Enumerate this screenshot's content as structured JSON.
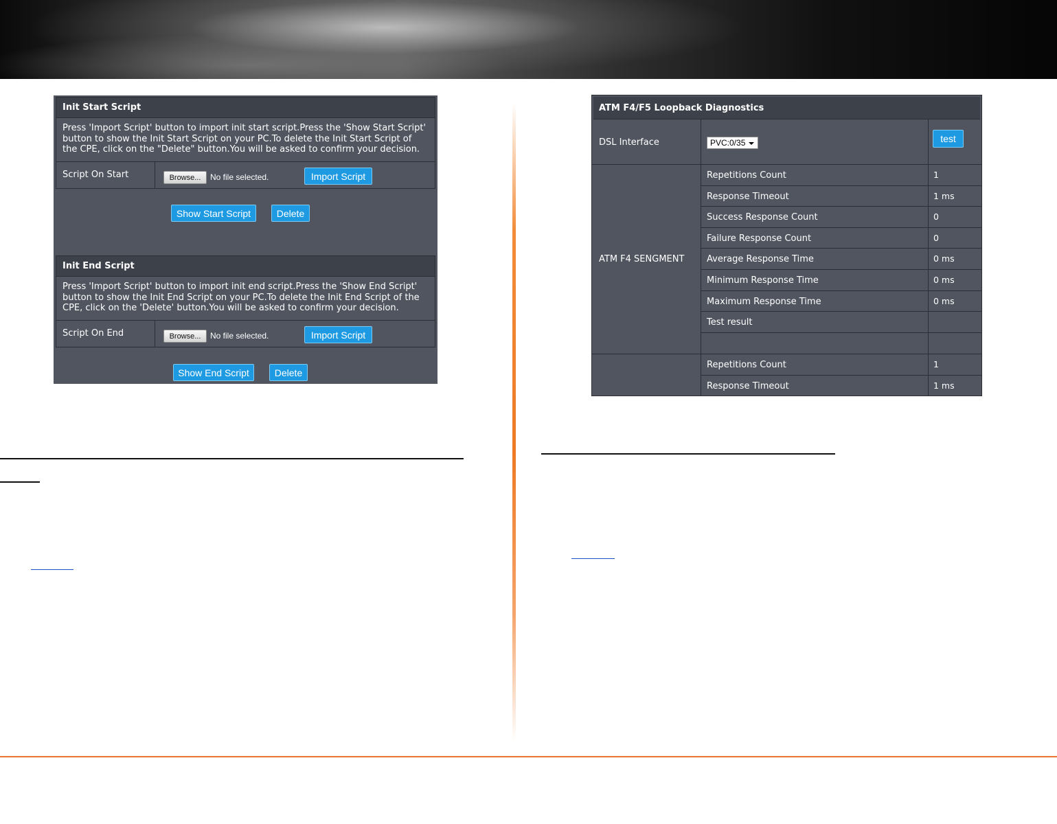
{
  "init_start": {
    "title": "Init Start Script",
    "description": "Press 'Import Script' button to import init start script.Press the 'Show Start Script' button to show the Init Start Script on your PC.To delete the Init Start Script of the CPE, click on the \"Delete\" button.You will be asked to confirm your decision.",
    "field_label": "Script On Start",
    "browse_label": "Browse...",
    "file_status": "No file selected.",
    "import_label": "Import Script",
    "show_label": "Show Start Script",
    "delete_label": "Delete"
  },
  "init_end": {
    "title": "Init End Script",
    "description": "Press 'Import Script' button to import init end script.Press the 'Show End Script' button to show the Init End Script on your PC.To delete the Init End Script of the CPE, click on the 'Delete' button.You will be asked to confirm your decision.",
    "field_label": "Script On End",
    "browse_label": "Browse...",
    "file_status": "No file selected.",
    "import_label": "Import Script",
    "show_label": "Show End Script",
    "delete_label": "Delete"
  },
  "atm": {
    "title": "ATM F4/F5 Loopback Diagnostics",
    "dsl_label": "DSL Interface",
    "dsl_value": "PVC:0/35",
    "test_label": "test",
    "segment_label": "ATM F4 SENGMENT",
    "rows": [
      {
        "label": "Repetitions Count",
        "value": "1"
      },
      {
        "label": "Response Timeout",
        "value": "1 ms"
      },
      {
        "label": "Success Response Count",
        "value": "0"
      },
      {
        "label": "Failure Response Count",
        "value": "0"
      },
      {
        "label": "Average Response Time",
        "value": "0 ms"
      },
      {
        "label": "Minimum Response Time",
        "value": "0 ms"
      },
      {
        "label": "Maximum Response Time",
        "value": "0 ms"
      },
      {
        "label": "Test result",
        "value": ""
      },
      {
        "label": "",
        "value": ""
      }
    ],
    "rows2": [
      {
        "label": "Repetitions Count",
        "value": "1"
      },
      {
        "label": "Response Timeout",
        "value": "1 ms"
      }
    ]
  }
}
